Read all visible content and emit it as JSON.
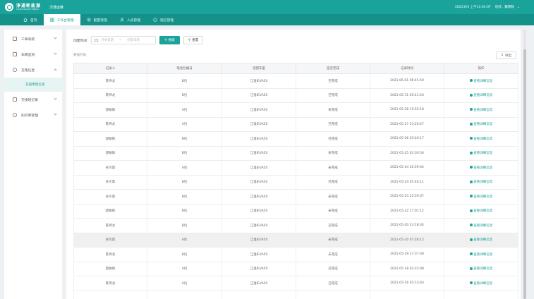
{
  "header": {
    "logo_cn": "淳通新能源",
    "logo_en": "CHUNTONG NEW ENERGY",
    "app_name": "淳通运维",
    "datetime": "2021/6/3 上午11:03:07",
    "user": "您好，魏明静",
    "accent": "#1aa39a"
  },
  "nav": {
    "items": [
      {
        "label": "首页",
        "icon": "home-icon"
      },
      {
        "label": "工作台管理",
        "icon": "grid-icon"
      },
      {
        "label": "配置管理",
        "icon": "gear-icon"
      },
      {
        "label": "人员管理",
        "icon": "user-icon"
      },
      {
        "label": "短信管理",
        "icon": "message-icon"
      }
    ],
    "active_index": 1
  },
  "sidebar": {
    "items": [
      {
        "label": "工单系统",
        "icon": "document-icon"
      },
      {
        "label": "车辆监测",
        "icon": "monitor-icon"
      },
      {
        "label": "充电信息",
        "icon": "clock-icon"
      },
      {
        "label": "充值用电信息",
        "icon": "",
        "sub": true
      },
      {
        "label": "交接班记录",
        "icon": "record-icon"
      },
      {
        "label": "知识库管理",
        "icon": "chat-icon"
      }
    ]
  },
  "filter": {
    "label": "创建时间",
    "start_placeholder": "开始日期",
    "separator": "~",
    "end_placeholder": "结束日期",
    "search_label": "搜索",
    "reset_label": "重置"
  },
  "list": {
    "title": "数据列表",
    "export_label": "导出"
  },
  "table": {
    "columns": [
      "记录人",
      "电池包编号",
      "适配车型",
      "是否完成",
      "记录时间",
      "操作"
    ],
    "action_label": "查看详细信息",
    "highlight_row": 11,
    "rows": [
      [
        "陈伟龙",
        "B包",
        "江淮IEVA50",
        "已完成",
        "2021-06-01 06:45:59"
      ],
      [
        "陈伟龙",
        "B包",
        "江淮IEVA50",
        "已完成",
        "2021-05-31 05:41:20"
      ],
      [
        "邵敏锋",
        "A包",
        "江淮IEVA50",
        "未完成",
        "2021-05-28 15:55:18"
      ],
      [
        "陈伟龙",
        "A包",
        "江淮IEVA50",
        "已完成",
        "2021-05-27 23:20:27"
      ],
      [
        "邵敏锋",
        "B包",
        "江淮IEVA50",
        "已完成",
        "2021-05-26 03:26:17"
      ],
      [
        "邵敏锋",
        "B包",
        "江淮IEVA50",
        "未完成",
        "2021-05-25 02:30:56"
      ],
      [
        "孙贝茹",
        "A包",
        "江淮IEVA50",
        "未完成",
        "2021-05-24 20:59:44"
      ],
      [
        "孙贝茹",
        "B包",
        "江淮IEVA50",
        "已完成",
        "2021-05-24 05:46:11"
      ],
      [
        "孙贝茹",
        "B包",
        "江淮IEVA50",
        "未完成",
        "2021-05-23 22:59:37"
      ],
      [
        "邵敏锋",
        "B包",
        "江淮IEVA50",
        "未完成",
        "2021-05-22 17:01:12"
      ],
      [
        "陈伟龙",
        "B包",
        "江淮IEVA50",
        "已完成",
        "2021-05-20 23:18:34"
      ],
      [
        "孙贝茹",
        "A包",
        "江淮IEVA50",
        "未完成",
        "2021-05-20 07:26:12"
      ],
      [
        "陈伟龙",
        "B包",
        "江淮IEVA50",
        "未完成",
        "2021-05-19 17:37:48"
      ],
      [
        "邵敏锋",
        "A包",
        "江淮IEVA50",
        "已完成",
        "2021-05-18 02:22:08"
      ],
      [
        "陈伟龙",
        "A包",
        "江淮IEVA50",
        "已完成",
        "2021-05-16 05:13:03"
      ],
      [
        "",
        "",
        "",
        "",
        ""
      ]
    ]
  }
}
